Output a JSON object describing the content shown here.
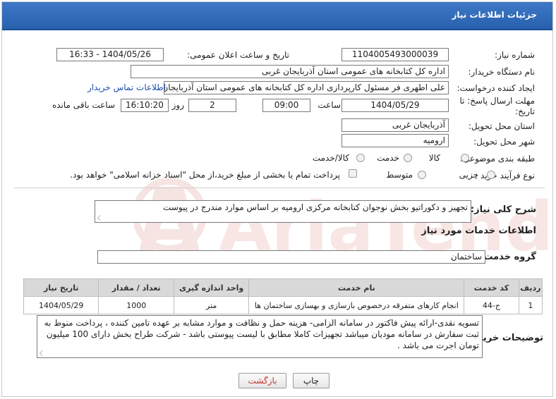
{
  "header": {
    "title": "جزئیات اطلاعات نیاز"
  },
  "form": {
    "need_number_label": "شماره نیاز:",
    "need_number_value": "1104005493000039",
    "announce_label": "تاریخ و ساعت اعلان عمومی:",
    "announce_value": "1404/05/26 - 16:33",
    "buyer_org_label": "نام دستگاه خریدار:",
    "buyer_org_value": "اداره کل کتابخانه های عمومی استان آذربایجان غربی",
    "requester_label": "ایجاد کننده درخواست:",
    "requester_value": "علی اطهری فر مسئول کارپردازی اداره کل کتابخانه های عمومی استان آذربایجان",
    "contact_link": "اطلاعات تماس خریدار",
    "deadline_label": "مهلت ارسال پاسخ: تا تاریخ:",
    "deadline_date": "1404/05/29",
    "time_label": "ساعت",
    "deadline_time": "09:00",
    "days_value": "2",
    "days_label": "روز و",
    "remaining_time": "16:10:20",
    "remaining_label": "ساعت باقی مانده",
    "province_label": "استان محل تحویل:",
    "province_value": "آذربایجان غربی",
    "city_label": "شهر محل تحویل:",
    "city_value": "ارومیه",
    "category_label": "طبقه بندی موضوعی:",
    "category_options": [
      "کالا",
      "خدمت",
      "کالا/خدمت"
    ],
    "process_label": "نوع فرآیند خرید :",
    "process_options": [
      "جزیی",
      "متوسط"
    ],
    "payment_note": "پرداخت تمام یا بخشی از مبلغ خرید،از محل \"اسناد خزانه اسلامی\" خواهد بود."
  },
  "description": {
    "label": "شرح کلی نیاز:",
    "value": "تجهیز و دکوراتیو بخش نوجوان کتابخانه مرکزی ارومیه بر اساس موارد مندرج در پیوست"
  },
  "services": {
    "section_title": "اطلاعات خدمات مورد نیاز",
    "group_label": "گروه خدمت:",
    "group_value": "ساختمان",
    "columns": [
      "ردیف",
      "کد خدمت",
      "نام خدمت",
      "واحد اندازه گیری",
      "تعداد / مقدار",
      "تاریخ نیاز"
    ],
    "rows": [
      [
        "1",
        "ج-44",
        "انجام کارهای متفرقه درخصوص بازسازی و بهسازی ساختمان ها",
        "متر",
        "1000",
        "1404/05/29"
      ]
    ]
  },
  "buyer_notes": {
    "label": "توضیحات خریدار:",
    "value": "تسویه نقدی-ارائه پیش فاکتور در سامانه  الزامی- هزینه حمل و نظافت و موارد مشابه بر عهده تامین کننده ، پرداخت منوط به ثبت سفارش در سامانه مودیان میباشد تجهیزات کاملا مطابق با لیست پیوستی باشد - شرکت طراح بخش دارای 100 میلیون تومان اجرت می باشد ."
  },
  "buttons": {
    "print": "چاپ",
    "back": "بازگشت"
  },
  "colors": {
    "header": "#2f6bbb",
    "link": "#1a4fae",
    "back_text": "#c0392b"
  }
}
